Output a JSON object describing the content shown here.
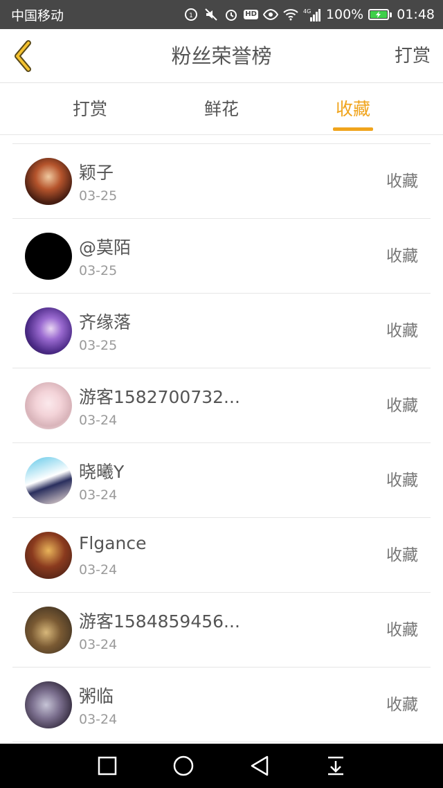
{
  "status_bar": {
    "carrier": "中国移动",
    "signal_type": "4G",
    "battery_percent": "100%",
    "time": "01:48",
    "hd_label": "HD"
  },
  "header": {
    "title": "粉丝荣誉榜",
    "right_action": "打赏"
  },
  "tabs": [
    {
      "label": "打赏",
      "active": false
    },
    {
      "label": "鲜花",
      "active": false
    },
    {
      "label": "收藏",
      "active": true
    }
  ],
  "accent_color": "#f0a41c",
  "list": [
    {
      "name": "颖子",
      "date": "03-25",
      "action": "收藏"
    },
    {
      "name": "@莫陌",
      "date": "03-25",
      "action": "收藏"
    },
    {
      "name": "齐缘落",
      "date": "03-25",
      "action": "收藏"
    },
    {
      "name": "游客1582700732...",
      "date": "03-24",
      "action": "收藏"
    },
    {
      "name": "晓曦Y",
      "date": "03-24",
      "action": "收藏"
    },
    {
      "name": "Flgance",
      "date": "03-24",
      "action": "收藏"
    },
    {
      "name": "游客1584859456...",
      "date": "03-24",
      "action": "收藏"
    },
    {
      "name": "粥临",
      "date": "03-24",
      "action": "收藏"
    }
  ],
  "icons": {
    "back": "chevron-left-icon",
    "nav": [
      "square-icon",
      "circle-icon",
      "triangle-back-icon",
      "download-icon"
    ]
  }
}
